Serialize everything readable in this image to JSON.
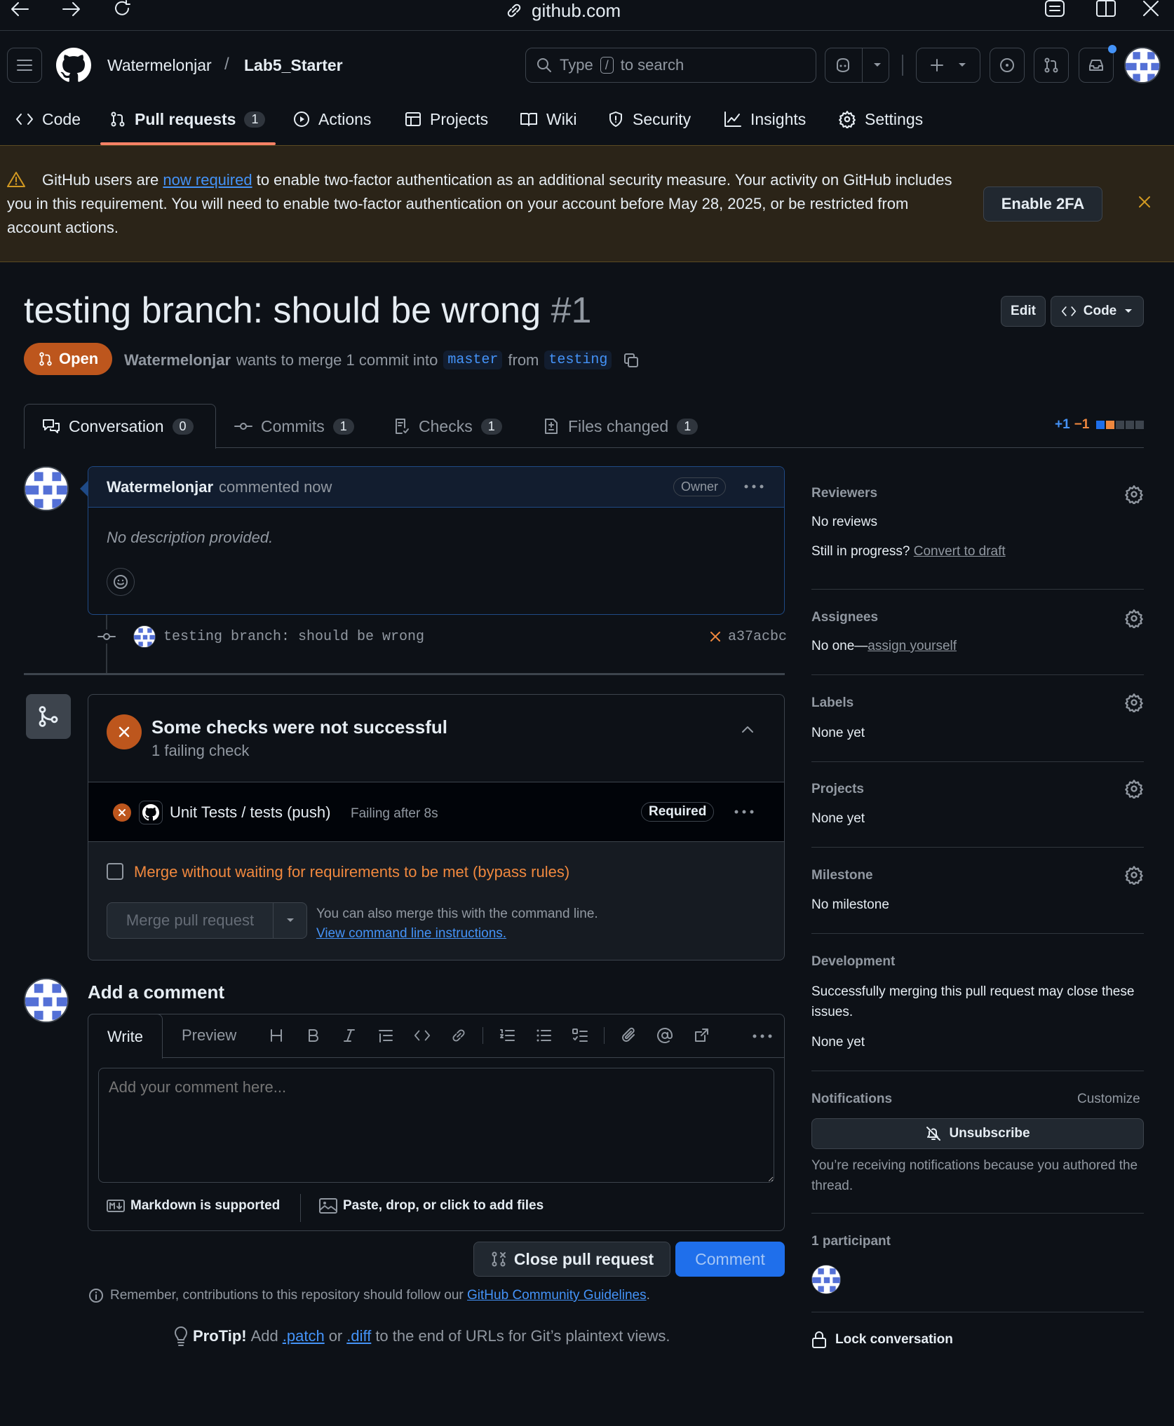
{
  "browser": {
    "url": "github.com"
  },
  "header": {
    "owner": "Watermelonjar",
    "separator": "/",
    "repo": "Lab5_Starter",
    "search": {
      "prefix": "Type",
      "key": "/",
      "suffix": "to search"
    }
  },
  "nav": {
    "items": [
      {
        "label": "Code",
        "icon": "code-icon"
      },
      {
        "label": "Pull requests",
        "icon": "git-pull-request-icon",
        "count": "1"
      },
      {
        "label": "Actions",
        "icon": "play-icon"
      },
      {
        "label": "Projects",
        "icon": "table-icon"
      },
      {
        "label": "Wiki",
        "icon": "book-icon"
      },
      {
        "label": "Security",
        "icon": "shield-icon"
      },
      {
        "label": "Insights",
        "icon": "graph-icon"
      },
      {
        "label": "Settings",
        "icon": "gear-icon"
      }
    ]
  },
  "banner": {
    "text_before": "GitHub users are ",
    "link": "now required",
    "text_after": " to enable two-factor authentication as an additional security measure. Your activity on GitHub includes you in this requirement. You will need to enable two-factor authentication on your account before May 28, 2025, or be restricted from account actions.",
    "button": "Enable 2FA"
  },
  "pr": {
    "title": "testing branch: should be wrong",
    "number": "#1",
    "edit_label": "Edit",
    "code_label": "Code",
    "state": "Open",
    "author": "Watermelonjar",
    "merge_text": "wants to merge 1 commit into",
    "base": "master",
    "from_text": "from",
    "head": "testing"
  },
  "tabs": [
    {
      "label": "Conversation",
      "count": "0"
    },
    {
      "label": "Commits",
      "count": "1"
    },
    {
      "label": "Checks",
      "count": "1"
    },
    {
      "label": "Files changed",
      "count": "1"
    }
  ],
  "diffstat": {
    "add": "+1",
    "del": "−1"
  },
  "comment": {
    "author": "Watermelonjar",
    "time": "commented now",
    "role": "Owner",
    "body": "No description provided."
  },
  "commit": {
    "message": "testing branch: should be wrong",
    "sha": "a37acbc"
  },
  "checks": {
    "title": "Some checks were not successful",
    "subtitle": "1 failing check",
    "item_name": "Unit Tests / tests (push)",
    "item_status": "Failing after 8s",
    "item_badge": "Required",
    "bypass_label": "Merge without waiting for requirements to be met (bypass rules)",
    "merge_button": "Merge pull request",
    "cli_text": "You can also merge this with the command line.",
    "cli_link": "View command line instructions."
  },
  "add_comment": {
    "heading": "Add a comment",
    "tab_write": "Write",
    "tab_preview": "Preview",
    "placeholder": "Add your comment here...",
    "markdown": "Markdown is supported",
    "files": "Paste, drop, or click to add files",
    "close_button": "Close pull request",
    "comment_button": "Comment",
    "remember_before": "Remember, contributions to this repository should follow our ",
    "remember_link": "GitHub Community Guidelines",
    "remember_after": "."
  },
  "protip": {
    "label": "ProTip!",
    "text1": "Add",
    "patch": ".patch",
    "or": "or",
    "diff": ".diff",
    "text2": "to the end of URLs for Git’s plaintext views."
  },
  "sidebar": {
    "reviewers": {
      "title": "Reviewers",
      "value": "No reviews",
      "progress": "Still in progress?",
      "draft": "Convert to draft"
    },
    "assignees": {
      "title": "Assignees",
      "prefix": "No one—",
      "link": "assign yourself"
    },
    "labels": {
      "title": "Labels",
      "value": "None yet"
    },
    "projects": {
      "title": "Projects",
      "value": "None yet"
    },
    "milestone": {
      "title": "Milestone",
      "value": "No milestone"
    },
    "development": {
      "title": "Development",
      "text": "Successfully merging this pull request may close these issues.",
      "value": "None yet"
    },
    "notifications": {
      "title": "Notifications",
      "customize": "Customize",
      "button": "Unsubscribe",
      "note": "You’re receiving notifications because you authored the thread."
    },
    "participants": {
      "title": "1 participant"
    },
    "lock": "Lock conversation"
  },
  "colors": {
    "accent": "#4493f8",
    "danger": "#f85149",
    "open": "#bd561d",
    "warning_text": "#f0883e",
    "bg": "#0d1117"
  }
}
